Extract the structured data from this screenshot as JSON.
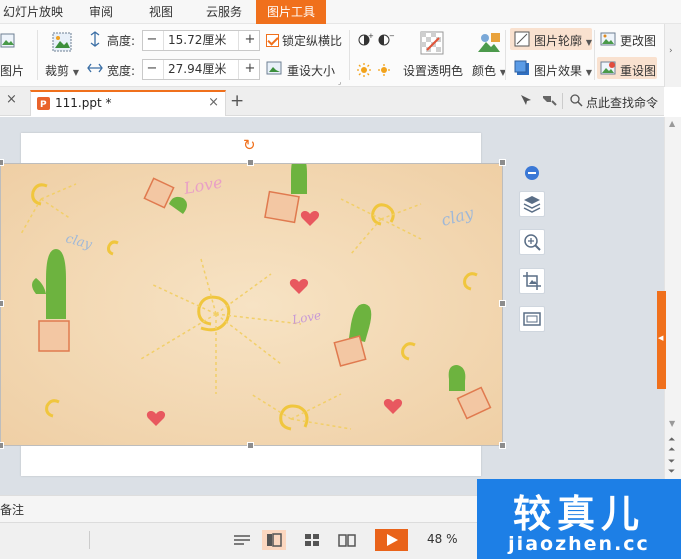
{
  "menu": {
    "tabs": [
      {
        "label": "幻灯片放映",
        "active": false
      },
      {
        "label": "审阅",
        "active": false
      },
      {
        "label": "视图",
        "active": false
      },
      {
        "label": "云服务",
        "active": false
      },
      {
        "label": "图片工具",
        "active": true
      }
    ]
  },
  "ribbon": {
    "insert_picture_label": "图片",
    "crop_label": "裁剪",
    "height_label": "高度:",
    "height_value": "15.72厘米",
    "width_label": "宽度:",
    "width_value": "27.94厘米",
    "lock_ratio_label": "锁定纵横比",
    "lock_ratio_checked": true,
    "reset_size_label": "重设大小",
    "set_transparent_label": "设置透明色",
    "color_label": "颜色",
    "picture_outline_label": "图片轮廓",
    "picture_effect_label": "图片效果",
    "change_picture_label": "更改图",
    "reset_picture_label": "重设图"
  },
  "tabbar": {
    "doc_name": "111.ppt *",
    "search_label": "点此查找命令"
  },
  "picture": {
    "doodle_texts": [
      "Love",
      "clay",
      "Love",
      "clay"
    ]
  },
  "notes": {
    "label": "备注"
  },
  "status": {
    "zoom": "48 %"
  },
  "watermark": {
    "title": "较真儿",
    "url": "jiaozhen.cc"
  },
  "colors": {
    "accent": "#f0701c",
    "watermark": "#1d7fe6"
  }
}
